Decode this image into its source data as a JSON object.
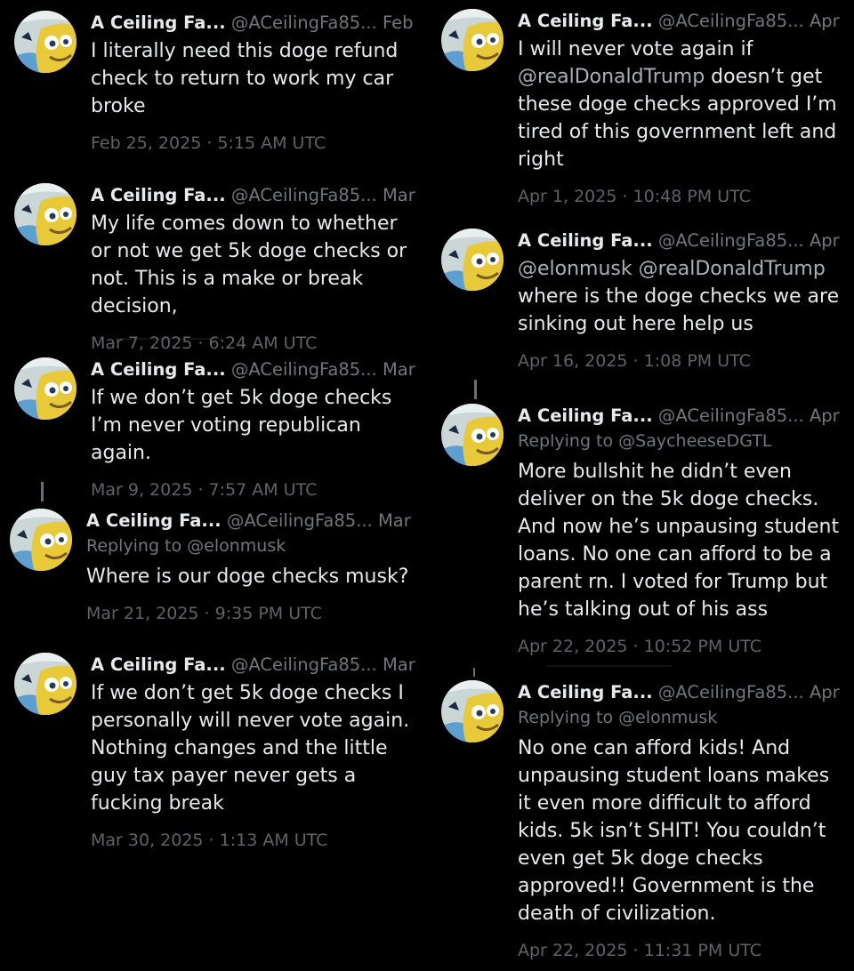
{
  "author": {
    "name": "A Ceiling Fa...",
    "handle": "@ACeilingFa85..."
  },
  "tweets": [
    {
      "date_short": "Feb 25",
      "text": "I literally need this doge refund check to return to work my car broke",
      "timestamp": "Feb 25, 2025 · 5:15 AM UTC"
    },
    {
      "date_short": "Mar 7",
      "text": "My life comes down to whether or not we get 5k doge checks or not. This is a make or break decision,",
      "timestamp": "Mar 7, 2025 · 6:24 AM UTC"
    },
    {
      "date_short": "Mar 9",
      "text": "If we don’t get 5k doge checks I’m never voting republican again.",
      "timestamp": "Mar 9, 2025 · 7:57 AM UTC"
    },
    {
      "date_short": "Mar 21",
      "replying_prefix": "Replying to ",
      "replying_to": "@elonmusk",
      "text": "Where is our doge checks musk?",
      "timestamp": "Mar 21, 2025 · 9:35 PM UTC"
    },
    {
      "date_short": "Mar 30",
      "text": "If we don’t get 5k doge checks I personally will never vote again. Nothing changes and the little guy tax payer never gets a fucking break",
      "timestamp": "Mar 30, 2025 · 1:13 AM UTC"
    },
    {
      "date_short": "Apr 1",
      "text_before": "I will never vote again if ",
      "mention": "@realDonaldTrump",
      "text_after": " doesn’t get these doge checks approved I’m tired of this government left and right",
      "timestamp": "Apr 1, 2025 · 10:48 PM UTC"
    },
    {
      "date_short": "Apr 16",
      "mention1": "@elonmusk",
      "mention2": "@realDonaldTrump",
      "text": "where is the doge checks we are sinking out here help us",
      "timestamp": "Apr 16, 2025 · 1:08 PM UTC"
    },
    {
      "date_short": "Apr 22",
      "replying_prefix": "Replying to ",
      "replying_to": "@SaycheeseDGTL",
      "text": "More bullshit he didn’t even deliver on the 5k doge checks. And now he’s unpausing student loans. No one can afford to be a parent rn. I voted for Trump but he’s talking out of his ass",
      "timestamp": "Apr 22, 2025 · 10:52 PM UTC"
    },
    {
      "date_short": "Apr 22",
      "replying_prefix": "Replying to ",
      "replying_to": "@elonmusk",
      "text": "No one can afford kids! And unpausing student loans makes it even more difficult to afford kids. 5k isn’t SHIT! You couldn’t even get 5k doge checks approved!! Government is the death of civilization.",
      "timestamp": "Apr 22, 2025 · 11:31 PM UTC"
    }
  ]
}
